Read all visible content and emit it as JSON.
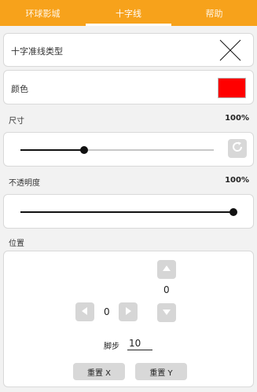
{
  "tabs": [
    {
      "label": "环球影城",
      "active": false
    },
    {
      "label": "十字线",
      "active": true
    },
    {
      "label": "帮助",
      "active": false
    }
  ],
  "crosshair_type": {
    "label": "十字准线类型",
    "icon": "crosshair-x-icon"
  },
  "color": {
    "label": "颜色",
    "value": "#ff0000"
  },
  "size": {
    "label": "尺寸",
    "value_text": "100%",
    "slider_fraction": 0.33,
    "reset_icon": "refresh-icon"
  },
  "opacity": {
    "label": "不透明度",
    "value_text": "100%",
    "slider_fraction": 1.0
  },
  "position": {
    "label": "位置",
    "y_value": "0",
    "x_value": "0",
    "step_label": "脚步",
    "step_value": "10",
    "reset_x_label": "重置 X",
    "reset_y_label": "重置 Y",
    "icons": {
      "up": "arrow-up-icon",
      "down": "arrow-down-icon",
      "left": "arrow-left-icon",
      "right": "arrow-right-icon"
    }
  },
  "colors": {
    "accent": "#f7a21b",
    "swatch": "#ff0000",
    "button": "#d6d6d6"
  }
}
